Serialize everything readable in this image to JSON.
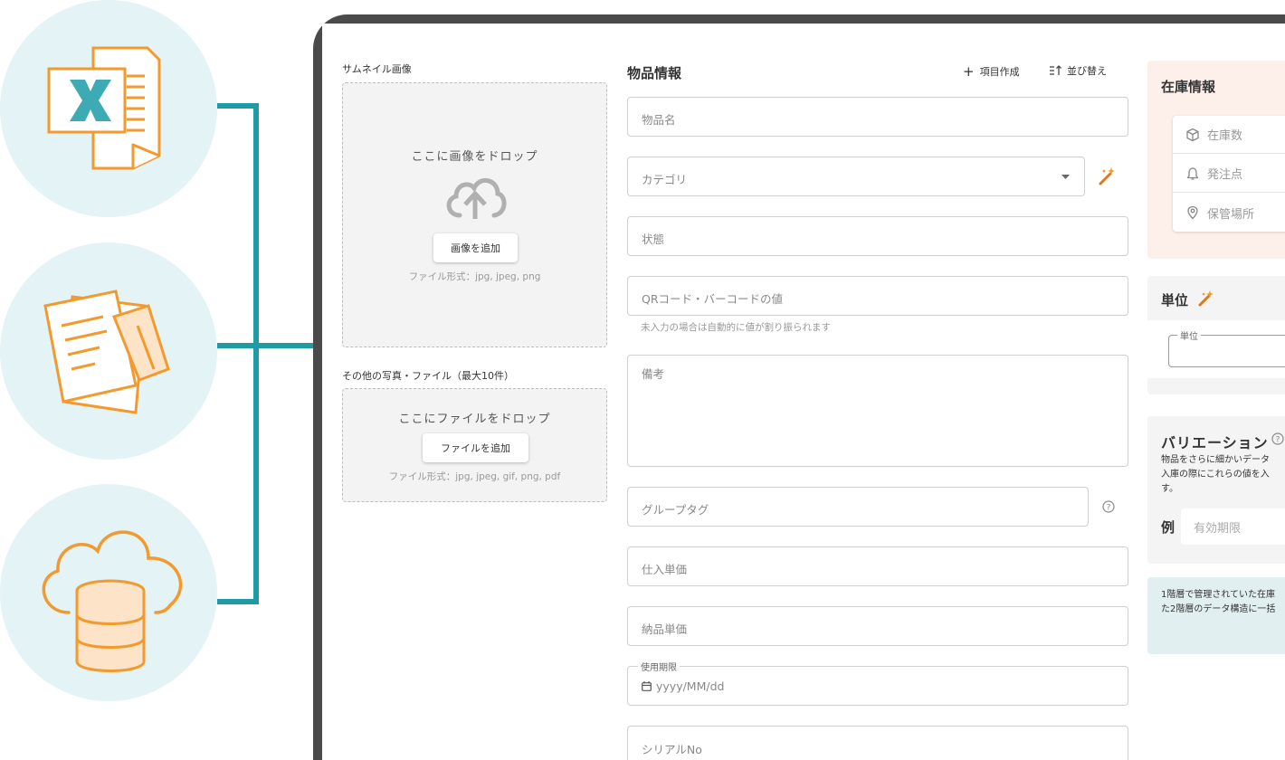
{
  "thumbnail": {
    "label": "サムネイル画像",
    "drop_text": "ここに画像をドロップ",
    "add_button": "画像を追加",
    "formats": "ファイル形式：jpg, jpeg, png"
  },
  "other_files": {
    "label": "その他の写真・ファイル（最大10件）",
    "drop_text": "ここにファイルをドロップ",
    "add_button": "ファイルを追加",
    "formats": "ファイル形式：jpg, jpeg, gif, png, pdf"
  },
  "item_info": {
    "title": "物品情報",
    "create_field": "項目作成",
    "sort": "並び替え",
    "fields": {
      "name": "物品名",
      "category": "カテゴリ",
      "status": "状態",
      "code": "QRコード・バーコードの値",
      "code_helper": "未入力の場合は自動的に値が割り振られます",
      "remarks": "備考",
      "group_tag": "グループタグ",
      "purchase_price": "仕入単価",
      "delivery_price": "納品単価",
      "expiry_label": "使用期限",
      "expiry_placeholder": "yyyy/MM/dd",
      "serial": "シリアルNo"
    }
  },
  "stock": {
    "title": "在庫情報",
    "fields": [
      "在庫数",
      "発注点",
      "保管場所"
    ]
  },
  "unit": {
    "title": "単位",
    "field_label": "単位"
  },
  "variation": {
    "title": "バリエーション",
    "desc_line1": "物品をさらに細かいデータ",
    "desc_line2": "入庫の際にこれらの値を入",
    "desc_line3": "す。",
    "example_label": "例",
    "example_value": "有効期限"
  },
  "notice": {
    "line1": "1階層で管理されていた在庫",
    "line2": "た2階層のデータ構造に一括"
  },
  "colors": {
    "accent_orange": "#f29a2e",
    "connector_teal": "#1f9ba6",
    "circle_bg": "#e3f3f6",
    "stock_panel_bg": "#fdf0ea",
    "notice_bg": "#e2eff1"
  },
  "icons": [
    "excel-icon",
    "documents-icon",
    "cloud-database-icon",
    "cloud-upload-icon",
    "plus-icon",
    "sort-icon",
    "caret-down-icon",
    "magic-wand-icon",
    "help-icon",
    "calendar-icon",
    "box-icon",
    "bell-icon",
    "location-pin-icon"
  ]
}
